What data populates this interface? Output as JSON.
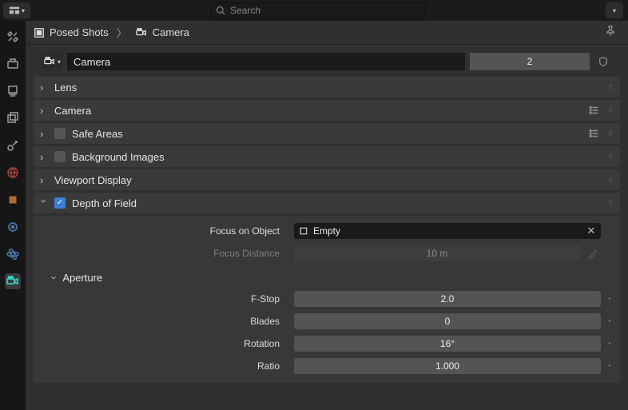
{
  "topbar": {
    "search_placeholder": "Search"
  },
  "breadcrumb": {
    "root": "Posed Shots",
    "leaf": "Camera"
  },
  "datablock": {
    "name": "Camera",
    "users": "2"
  },
  "panels": {
    "lens": {
      "title": "Lens"
    },
    "camera": {
      "title": "Camera"
    },
    "safe_areas": {
      "title": "Safe Areas"
    },
    "bg_images": {
      "title": "Background Images"
    },
    "viewport": {
      "title": "Viewport Display"
    },
    "dof": {
      "title": "Depth of Field",
      "focus_object_label": "Focus on Object",
      "focus_object_value": "Empty",
      "focus_distance_label": "Focus Distance",
      "focus_distance_value": "10 m",
      "aperture": {
        "title": "Aperture",
        "fstop_label": "F-Stop",
        "fstop_value": "2.0",
        "blades_label": "Blades",
        "blades_value": "0",
        "rotation_label": "Rotation",
        "rotation_value": "16°",
        "ratio_label": "Ratio",
        "ratio_value": "1.000"
      }
    }
  }
}
